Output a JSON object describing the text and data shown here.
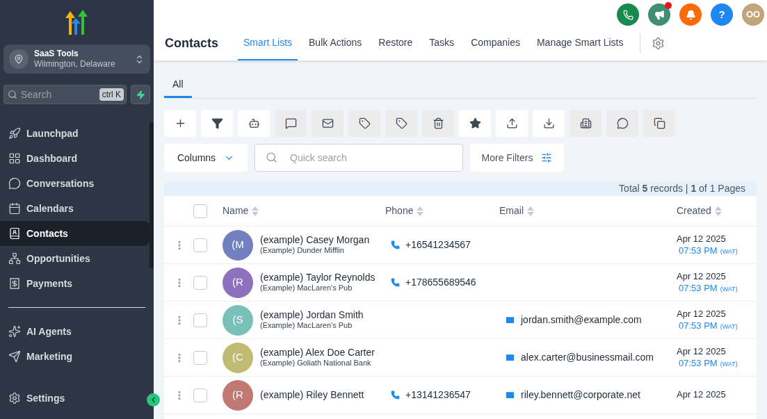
{
  "sidebar": {
    "account": {
      "name": "SaaS Tools",
      "location": "Wilmington, Delaware"
    },
    "search": {
      "placeholder": "Search",
      "shortcut": "ctrl K"
    },
    "items": [
      {
        "label": "Launchpad",
        "selected": false
      },
      {
        "label": "Dashboard",
        "selected": false
      },
      {
        "label": "Conversations",
        "selected": false
      },
      {
        "label": "Calendars",
        "selected": false
      },
      {
        "label": "Contacts",
        "selected": true
      },
      {
        "label": "Opportunities",
        "selected": false
      },
      {
        "label": "Payments",
        "selected": false
      }
    ],
    "items_2": [
      {
        "label": "AI Agents",
        "selected": false
      },
      {
        "label": "Marketing",
        "selected": false
      }
    ],
    "settings": {
      "label": "Settings"
    }
  },
  "header": {
    "buttons": [
      {
        "kind": "phone",
        "color": "#188a4f",
        "badge": false
      },
      {
        "kind": "megaphone",
        "color": "#3f8f71",
        "badge": true
      },
      {
        "kind": "bell",
        "color": "#fd6a0a",
        "badge": false
      },
      {
        "kind": "help",
        "color": "#1e88f0",
        "badge": false,
        "text": "?"
      },
      {
        "kind": "avatar",
        "color": "#c1a478",
        "badge": false,
        "text": "OO"
      }
    ]
  },
  "title": "Contacts",
  "tabs": [
    {
      "label": "Smart Lists",
      "selected": true
    },
    {
      "label": "Bulk Actions",
      "selected": false
    },
    {
      "label": "Restore",
      "selected": false
    },
    {
      "label": "Tasks",
      "selected": false
    },
    {
      "label": "Companies",
      "selected": false
    },
    {
      "label": "Manage Smart Lists",
      "selected": false
    }
  ],
  "list_tabs": [
    {
      "label": "All",
      "selected": true
    }
  ],
  "toolbar": [
    {
      "kind": "add",
      "disabled": false
    },
    {
      "kind": "filter",
      "disabled": false
    },
    {
      "kind": "bot",
      "disabled": false
    },
    {
      "kind": "message",
      "disabled": true
    },
    {
      "kind": "email",
      "disabled": true
    },
    {
      "kind": "tag_add",
      "disabled": true
    },
    {
      "kind": "tag_remove",
      "disabled": true
    },
    {
      "kind": "delete",
      "disabled": true
    },
    {
      "kind": "star",
      "disabled": false
    },
    {
      "kind": "export",
      "disabled": false
    },
    {
      "kind": "import",
      "disabled": false
    },
    {
      "kind": "company",
      "disabled": true
    },
    {
      "kind": "whatsapp",
      "disabled": true
    },
    {
      "kind": "duplicate",
      "disabled": true
    }
  ],
  "columns_button": "Columns",
  "quick_search": {
    "placeholder": "Quick search"
  },
  "more_filters": "More Filters",
  "summary": "Total **5** records | **1** of 1 Pages",
  "table": {
    "select_all_checked": false,
    "columns": [
      "Name",
      "Phone",
      "Email",
      "Created"
    ],
    "rows": [
      {
        "checked": false,
        "initials": "(M",
        "color": "#7380c0",
        "name": "(example) Casey Morgan",
        "company": "(Example) Dunder Mifflin",
        "phone": "+16541234567",
        "date": "Apr 12 2025",
        "time": "07:53 PM",
        "tz": "(WAT)"
      },
      {
        "checked": false,
        "initials": "(R",
        "color": "#8d71bd",
        "name": "(example) Taylor Reynolds",
        "company": "(Example) MacLaren's Pub",
        "phone": "+178655689546",
        "date": "Apr 12 2025",
        "time": "07:53 PM",
        "tz": "(WAT)"
      },
      {
        "checked": false,
        "initials": "(S",
        "color": "#79c0b9",
        "name": "(example) Jordan Smith",
        "company": "(Example) MacLaren's Pub",
        "email": "jordan.smith@example.com",
        "date": "Apr 12 2025",
        "time": "07:53 PM",
        "tz": "(WAT)"
      },
      {
        "checked": false,
        "initials": "(C",
        "color": "#c0bb73",
        "name": "(example) Alex Doe Carter",
        "company": "(Example) Goliath National Bank",
        "email": "alex.carter@businessmail.com",
        "date": "Apr 12 2025",
        "time": "07:53 PM",
        "tz": "(WAT)"
      },
      {
        "checked": false,
        "initials": "(R",
        "color": "#c07873",
        "name": "(example) Riley Bennett",
        "phone": "+13141236547",
        "email": "riley.bennett@corporate.net",
        "date": "Apr 12 2025"
      }
    ]
  }
}
